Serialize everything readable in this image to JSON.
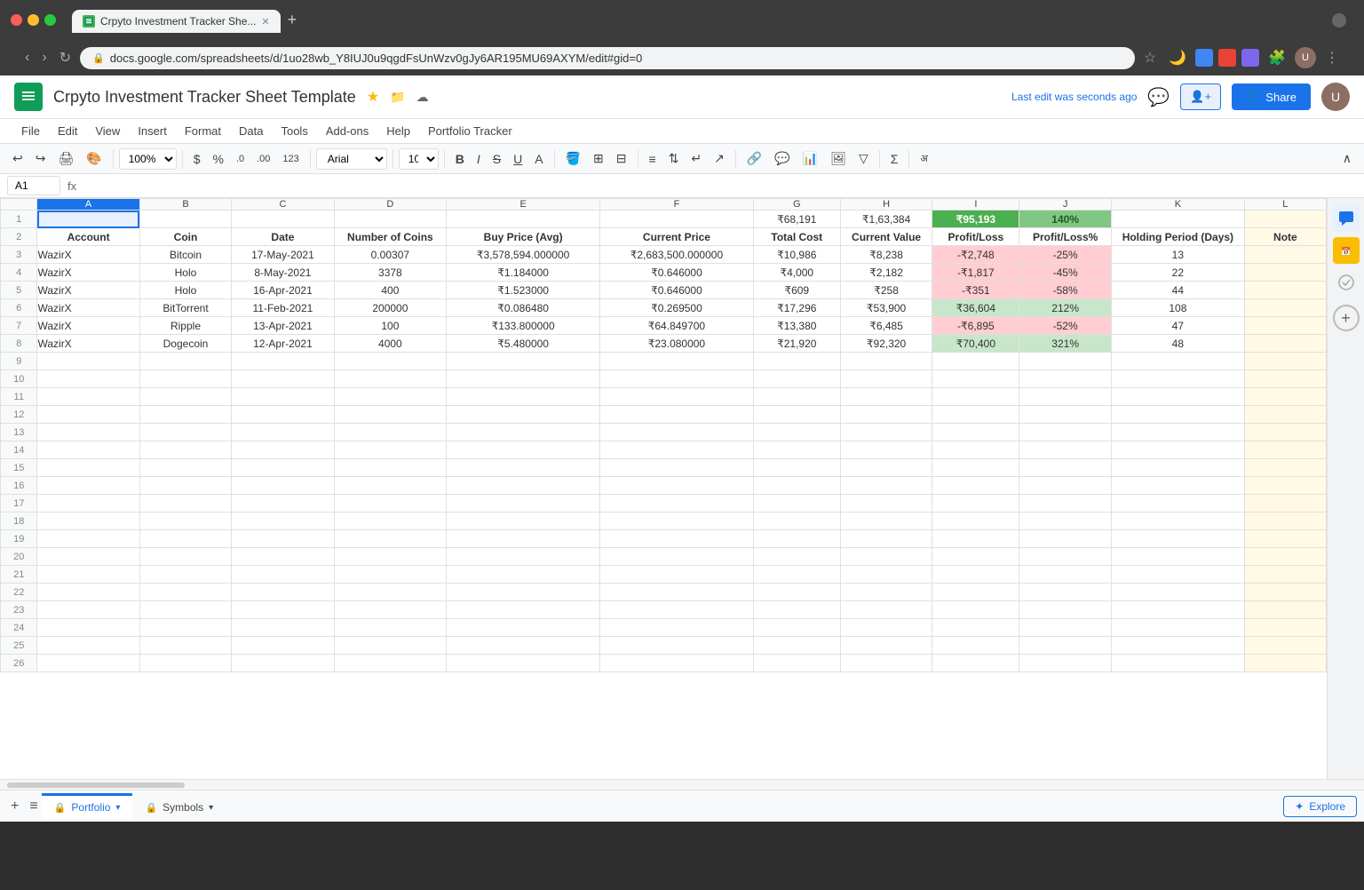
{
  "browser": {
    "traffic_lights": [
      "red",
      "yellow",
      "green"
    ],
    "tab_title": "Crpyto Investment Tracker She...",
    "new_tab_label": "+",
    "url": "docs.google.com/spreadsheets/d/1uo28wb_Y8IUJ0u9qgdFsUnWzv0gJy6AR195MU69AXYM/edit#gid=0",
    "nav_back": "‹",
    "nav_forward": "›",
    "nav_refresh": "↻"
  },
  "app_header": {
    "logo": "≡",
    "title": "Crpyto Investment Tracker Sheet Template",
    "star": "★",
    "last_edit": "Last edit was seconds ago",
    "share_label": "Share",
    "menu_items": [
      "File",
      "Edit",
      "View",
      "Insert",
      "Format",
      "Data",
      "Tools",
      "Add-ons",
      "Help",
      "Portfolio Tracker"
    ]
  },
  "toolbar": {
    "undo": "↩",
    "redo": "↪",
    "print": "🖨",
    "paint": "🎨",
    "zoom": "100%",
    "dollar": "$",
    "percent": "%",
    "comma": ".0",
    "decimal": ".00",
    "number": "123",
    "font": "Arial",
    "font_size": "10",
    "bold": "B",
    "italic": "I",
    "strikethrough": "S",
    "underline": "U"
  },
  "formula_bar": {
    "cell_ref": "A1",
    "fx": "fx"
  },
  "spreadsheet": {
    "columns": [
      "",
      "A",
      "B",
      "C",
      "D",
      "E",
      "F",
      "G",
      "H",
      "I",
      "J",
      "K",
      "L"
    ],
    "row1": {
      "g": "₹68,191",
      "h": "₹1,63,384",
      "i": "₹95,193",
      "j": "140%"
    },
    "row2_headers": [
      "Account",
      "Coin",
      "Date",
      "Number of Coins",
      "Buy Price (Avg)",
      "Current Price",
      "Total Cost",
      "Current Value",
      "Profit/Loss",
      "Profit/Loss%",
      "Holding Period (Days)",
      "Note"
    ],
    "rows": [
      {
        "row": 3,
        "account": "WazirX",
        "coin": "Bitcoin",
        "date": "17-May-2021",
        "num_coins": "0.00307",
        "buy_price": "₹3,578,594.000000",
        "curr_price": "₹2,683,500.000000",
        "total_cost": "₹10,986",
        "curr_value": "₹8,238",
        "profit_loss": "-₹2,748",
        "pl_pct": "-25%",
        "holding": "13"
      },
      {
        "row": 4,
        "account": "WazirX",
        "coin": "Holo",
        "date": "8-May-2021",
        "num_coins": "3378",
        "buy_price": "₹1.184000",
        "curr_price": "₹0.646000",
        "total_cost": "₹4,000",
        "curr_value": "₹2,182",
        "profit_loss": "-₹1,817",
        "pl_pct": "-45%",
        "holding": "22"
      },
      {
        "row": 5,
        "account": "WazirX",
        "coin": "Holo",
        "date": "16-Apr-2021",
        "num_coins": "400",
        "buy_price": "₹1.523000",
        "curr_price": "₹0.646000",
        "total_cost": "₹609",
        "curr_value": "₹258",
        "profit_loss": "-₹351",
        "pl_pct": "-58%",
        "holding": "44"
      },
      {
        "row": 6,
        "account": "WazirX",
        "coin": "BitTorrent",
        "date": "11-Feb-2021",
        "num_coins": "200000",
        "buy_price": "₹0.086480",
        "curr_price": "₹0.269500",
        "total_cost": "₹17,296",
        "curr_value": "₹53,900",
        "profit_loss": "₹36,604",
        "pl_pct": "212%",
        "holding": "108"
      },
      {
        "row": 7,
        "account": "WazirX",
        "coin": "Ripple",
        "date": "13-Apr-2021",
        "num_coins": "100",
        "buy_price": "₹133.800000",
        "curr_price": "₹64.849700",
        "total_cost": "₹13,380",
        "curr_value": "₹6,485",
        "profit_loss": "-₹6,895",
        "pl_pct": "-52%",
        "holding": "47"
      },
      {
        "row": 8,
        "account": "WazirX",
        "coin": "Dogecoin",
        "date": "12-Apr-2021",
        "num_coins": "4000",
        "buy_price": "₹5.480000",
        "curr_price": "₹23.080000",
        "total_cost": "₹21,920",
        "curr_value": "₹92,320",
        "profit_loss": "₹70,400",
        "pl_pct": "321%",
        "holding": "48"
      }
    ],
    "empty_rows": [
      9,
      10,
      11,
      12,
      13,
      14,
      15,
      16,
      17,
      18,
      19,
      20,
      21,
      22,
      23,
      24,
      25,
      26
    ]
  },
  "bottom_tabs": {
    "add_label": "+",
    "list_icon": "≡",
    "tabs": [
      {
        "name": "Portfolio",
        "active": true
      },
      {
        "name": "Symbols",
        "active": false
      }
    ],
    "explore_label": "Explore"
  },
  "right_sidebar": {
    "icons": [
      "chat",
      "calendar",
      "tasks",
      "add"
    ]
  },
  "colors": {
    "green_header": "#4caf50",
    "light_green": "#c8e6c9",
    "light_red": "#ffcdd2",
    "green_text": "#2e7d32",
    "red_text": "#c62828",
    "brand_blue": "#1a73e8",
    "sheets_green": "#0f9d58"
  }
}
